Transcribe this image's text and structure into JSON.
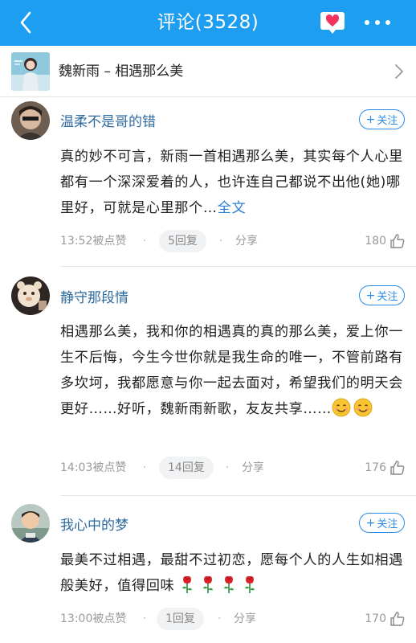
{
  "header": {
    "title": "评论(3528)",
    "bg_color": "#1e9ef0"
  },
  "song": {
    "title": "魏新雨 – 相遇那么美"
  },
  "comments": [
    {
      "username": "温柔不是哥的错",
      "follow_label": "关注",
      "text": "真的妙不可言，新雨一首相遇那么美，其实每个人心里都有一个深深爱着的人，也许连自己都说不出他(她)哪里好，可就是心里那个…",
      "more_label": "全文",
      "time": "13:52被点赞",
      "reply": "5回复",
      "share": "分享",
      "likes": "180"
    },
    {
      "username": "静守那段情",
      "follow_label": "关注",
      "text": "相遇那么美，我和你的相遇真的真的那么美，爱上你一生不后悔，今生今世你就是我生命的唯一，不管前路有多坎坷，我都愿意与你一起去面对，希望我们的明天会更好……好听，魏新雨新歌，友友共享……",
      "time": "14:03被点赞",
      "reply": "14回复",
      "share": "分享",
      "likes": "176"
    },
    {
      "username": "我心中的梦",
      "follow_label": "关注",
      "text": "最美不过相遇，最甜不过初恋，愿每个人的人生如相遇般美好，值得回味",
      "time": "13:00被点赞",
      "reply": "1回复",
      "share": "分享",
      "likes": "170"
    }
  ],
  "icons": {
    "back": "chevron-left-icon",
    "heart": "heart-speech-icon",
    "more": "more-dots-icon",
    "chevron": "chevron-right-icon",
    "like": "thumbs-up-icon",
    "smile": "smile-emoji-icon",
    "rose": "rose-emoji-icon"
  },
  "colors": {
    "accent": "#1e9ef0",
    "username": "#2d6a9f",
    "link": "#2a7fd4"
  }
}
